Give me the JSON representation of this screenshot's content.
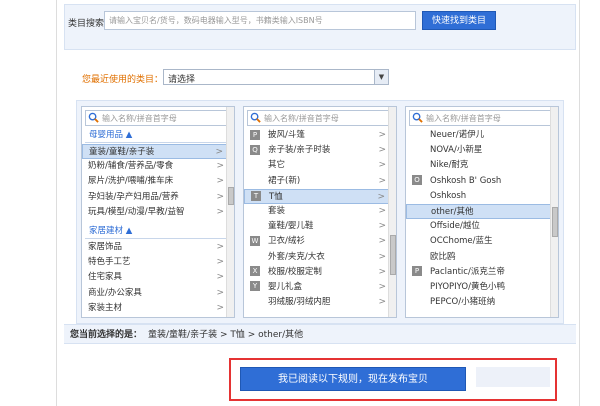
{
  "search": {
    "label": "类目搜索：",
    "placeholder": "请输入宝贝名/货号，数码电器输入型号，书籍类输入ISBN号",
    "button": "快速找到类目"
  },
  "recent": {
    "label": "您最近使用的类目：",
    "value": "请选择"
  },
  "column_search_placeholder": "输入名称/拼音首字母",
  "col1": {
    "group1": "母婴用品 ▲",
    "items1": [
      {
        "label": "童装/童鞋/亲子装",
        "chevron": ">"
      },
      {
        "label": "奶粉/辅食/营养品/零食",
        "chevron": ">"
      },
      {
        "label": "尿片/洗护/喂哺/推车床",
        "chevron": ">"
      },
      {
        "label": "孕妇装/孕产妇用品/营养",
        "chevron": ">"
      },
      {
        "label": "玩具/模型/动漫/早教/益智",
        "chevron": ">"
      }
    ],
    "group2": "家居建材 ▲",
    "items2": [
      {
        "label": "家居饰品",
        "chevron": ">"
      },
      {
        "label": "特色手工艺",
        "chevron": ">"
      },
      {
        "label": "住宅家具",
        "chevron": ">"
      },
      {
        "label": "商业/办公家具",
        "chevron": ">"
      },
      {
        "label": "家装主材",
        "chevron": ">"
      }
    ]
  },
  "col2": {
    "items": [
      {
        "letter": "P",
        "label": "披风/斗篷",
        "chevron": ">"
      },
      {
        "letter": "Q",
        "label": "亲子装/亲子时装",
        "chevron": ">"
      },
      {
        "letter": "",
        "label": "其它",
        "chevron": ">"
      },
      {
        "letter": "",
        "label": "裙子(新)",
        "chevron": ">"
      },
      {
        "letter": "T",
        "label": "T恤",
        "chevron": ">"
      },
      {
        "letter": "",
        "label": "套装",
        "chevron": ">"
      },
      {
        "letter": "",
        "label": "童鞋/婴儿鞋",
        "chevron": ">"
      },
      {
        "letter": "W",
        "label": "卫衣/绒衫",
        "chevron": ">"
      },
      {
        "letter": "",
        "label": "外套/夹克/大衣",
        "chevron": ">"
      },
      {
        "letter": "X",
        "label": "校服/校服定制",
        "chevron": ">"
      },
      {
        "letter": "Y",
        "label": "婴儿礼盒",
        "chevron": ">"
      },
      {
        "letter": "",
        "label": "羽绒服/羽绒内胆",
        "chevron": ">"
      }
    ]
  },
  "col3": {
    "items": [
      {
        "letter": "",
        "label": "Neuer/诺伊儿"
      },
      {
        "letter": "",
        "label": "NOVA/小新星"
      },
      {
        "letter": "",
        "label": "Nike/耐克"
      },
      {
        "letter": "O",
        "label": "Oshkosh B' Gosh"
      },
      {
        "letter": "",
        "label": "Oshkosh"
      },
      {
        "letter": "",
        "label": "other/其他"
      },
      {
        "letter": "",
        "label": "Offside/越位"
      },
      {
        "letter": "",
        "label": "OCChome/蓝生"
      },
      {
        "letter": "",
        "label": "欧比鸥"
      },
      {
        "letter": "P",
        "label": "Paclantic/派克兰帝"
      },
      {
        "letter": "",
        "label": "PIYOPIYO/黄色小鸭"
      },
      {
        "letter": "",
        "label": "PEPCO/小猪班纳"
      }
    ]
  },
  "current": {
    "label": "您当前选择的是：",
    "path": "童装/童鞋/亲子装 > T恤 > other/其他"
  },
  "publish_button": "我已阅读以下规则，现在发布宝贝"
}
